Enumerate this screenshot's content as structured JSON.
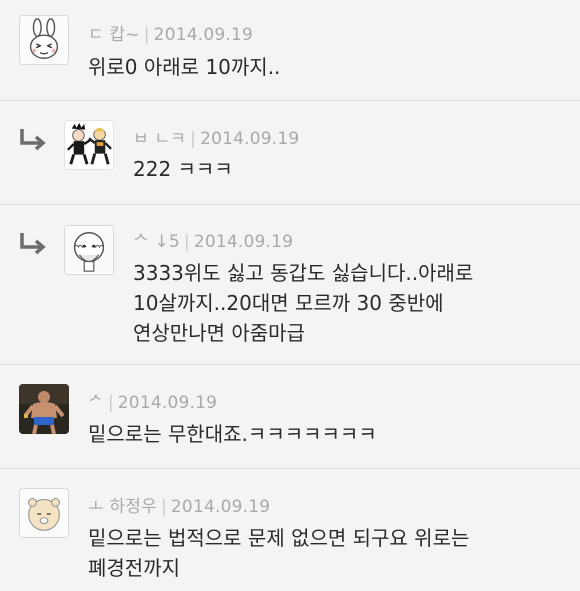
{
  "comments": [
    {
      "author": "ㄷ          캅~",
      "date": "2014.09.19",
      "text": "위로0 아래로 10까지..",
      "is_reply": false,
      "avatar_icon": "bunny-face-icon"
    },
    {
      "author": "ㅂ       ㄴㅋ",
      "date": "2014.09.19",
      "text": "222 ㅋㅋㅋ",
      "is_reply": true,
      "avatar_icon": "dancing-characters-icon"
    },
    {
      "author": "ᄉ         ↓5",
      "date": "2014.09.19",
      "text": "3333위도 싫고 동갑도 싫습니다..아래로\n10살까지..20대면 모르까 30 중반에\n연상만나면 아줌마급",
      "is_reply": true,
      "avatar_icon": "bearded-character-icon"
    },
    {
      "author": "ᄼ",
      "date": "2014.09.19",
      "text": "밑으로는 무한대죠.ㅋㅋㅋㅋㅋㅋㅋ",
      "is_reply": false,
      "avatar_icon": "fighter-photo-icon"
    },
    {
      "author": "ㅗ         하정우",
      "date": "2014.09.19",
      "text": "밑으로는 법적으로 문제 없으면 되구요 위로는\n폐경전까지",
      "is_reply": false,
      "avatar_icon": "round-face-character-icon"
    }
  ]
}
